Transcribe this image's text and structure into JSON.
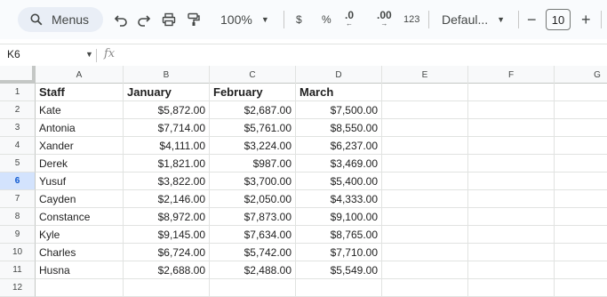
{
  "toolbar": {
    "menus_label": "Menus",
    "zoom": "100%",
    "currency": "$",
    "percent": "%",
    "decrease_decimal": ".0",
    "increase_decimal": ".00",
    "format_123": "123",
    "font": "Defaul...",
    "font_size": "10",
    "minus": "−",
    "plus": "+"
  },
  "formula_bar": {
    "cell_ref": "K6",
    "fx": "fx"
  },
  "columns": [
    "A",
    "B",
    "C",
    "D",
    "E",
    "F",
    "G"
  ],
  "rows": [
    "1",
    "2",
    "3",
    "4",
    "5",
    "6",
    "7",
    "8",
    "9",
    "10",
    "11",
    "12"
  ],
  "selected_row": "6",
  "table": {
    "headers": [
      "Staff",
      "January",
      "February",
      "March"
    ],
    "data": [
      [
        "Kate",
        "$5,872.00",
        "$2,687.00",
        "$7,500.00"
      ],
      [
        "Antonia",
        "$7,714.00",
        "$5,761.00",
        "$8,550.00"
      ],
      [
        "Xander",
        "$4,111.00",
        "$3,224.00",
        "$6,237.00"
      ],
      [
        "Derek",
        "$1,821.00",
        "$987.00",
        "$3,469.00"
      ],
      [
        "Yusuf",
        "$3,822.00",
        "$3,700.00",
        "$5,400.00"
      ],
      [
        "Cayden",
        "$2,146.00",
        "$2,050.00",
        "$4,333.00"
      ],
      [
        "Constance",
        "$8,972.00",
        "$7,873.00",
        "$9,100.00"
      ],
      [
        "Kyle",
        "$9,145.00",
        "$7,634.00",
        "$8,765.00"
      ],
      [
        "Charles",
        "$6,724.00",
        "$5,742.00",
        "$7,710.00"
      ],
      [
        "Husna",
        "$2,688.00",
        "$2,488.00",
        "$5,549.00"
      ]
    ]
  },
  "colors": {
    "toolbar_bg": "#f9fbfd",
    "header_bg": "#f8f9fa",
    "selected_row": "#d3e3fd",
    "accent": "#0b57d0"
  }
}
